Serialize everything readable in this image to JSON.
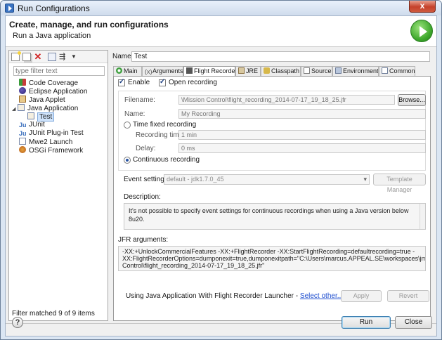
{
  "window": {
    "title": "Run Configurations",
    "close_glyph": "x"
  },
  "header": {
    "title": "Create, manage, and run configurations",
    "subtitle": "Run a Java application"
  },
  "left": {
    "filter_placeholder": "type filter text",
    "tree": [
      {
        "label": "Code Coverage",
        "icon": "coverage-icon"
      },
      {
        "label": "Eclipse Application",
        "icon": "eclipse-icon"
      },
      {
        "label": "Java Applet",
        "icon": "applet-icon"
      },
      {
        "label": "Java Application",
        "icon": "java-app-icon"
      },
      {
        "label": "Test",
        "icon": "java-class-icon"
      },
      {
        "label": "JUnit",
        "icon": "junit-icon"
      },
      {
        "label": "JUnit Plug-in Test",
        "icon": "junit-plugin-icon"
      },
      {
        "label": "Mwe2 Launch",
        "icon": "mwe2-icon"
      },
      {
        "label": "OSGi Framework",
        "icon": "osgi-icon"
      }
    ],
    "status": "Filter matched 9 of 9 items"
  },
  "right": {
    "name_label": "Name:",
    "name_value": "Test",
    "tabs": [
      "Main",
      "Arguments",
      "Flight Recorder",
      "JRE",
      "Classpath",
      "Source",
      "Environment",
      "Common"
    ],
    "active_tab": "Flight Recorder",
    "enable_label": "Enable",
    "open_recording_label": "Open recording",
    "filename_label": "Filename:",
    "filename_value": "\\Mission Control\\flight_recording_2014-07-17_19_18_25.jfr",
    "browse_label": "Browse...",
    "rec_name_label": "Name:",
    "rec_name_value": "My Recording",
    "time_fixed_label": "Time fixed recording",
    "recording_time_label": "Recording time:",
    "recording_time_value": "1 min",
    "delay_label": "Delay:",
    "delay_value": "0 ms",
    "continuous_label": "Continuous recording",
    "event_settings_label": "Event settings:",
    "event_settings_value": "default - jdk1.7.0_45",
    "template_manager_label": "Template Manager",
    "description_label": "Description:",
    "description_text": "It's not possible to specify event settings for continuous recordings when using a Java version below 8u20.",
    "jfr_label": "JFR arguments:",
    "jfr_text": "-XX:+UnlockCommercialFeatures -XX:+FlightRecorder -XX:StartFlightRecording=defaultrecording=true -XX:FlightRecorderOptions=dumponexit=true,dumponexitpath=\"C:\\Users\\marcus.APPEAL.SE\\workspaces\\jmc_eclipse\\Mission Control\\flight_recording_2014-07-17_19_18_25.jfr\"",
    "launcher_text": "Using Java Application With Flight Recorder Launcher - ",
    "launcher_link": "Select other...",
    "apply_label": "Apply",
    "revert_label": "Revert"
  },
  "footer": {
    "help_glyph": "?",
    "run_label": "Run",
    "close_label": "Close"
  }
}
